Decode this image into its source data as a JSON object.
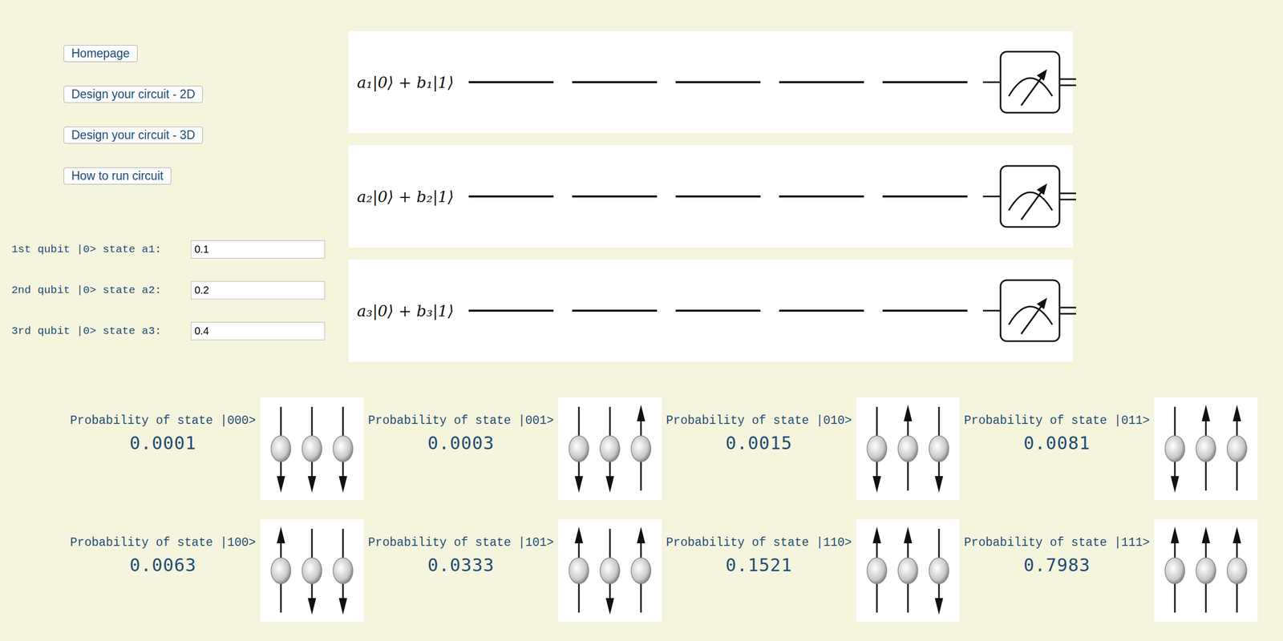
{
  "nav": {
    "buttons": [
      "Homepage",
      "Design your circuit - 2D",
      "Design your circuit - 3D",
      "How to run circuit"
    ]
  },
  "inputs": [
    {
      "label": "1st qubit |0> state a1:",
      "value": "0.1"
    },
    {
      "label": "2nd qubit |0> state a2:",
      "value": "0.2"
    },
    {
      "label": "3rd qubit |0> state a3:",
      "value": "0.4"
    }
  ],
  "circuit": {
    "qubits": [
      {
        "label": "a₁|0⟩ + b₁|1⟩"
      },
      {
        "label": "a₂|0⟩ + b₂|1⟩"
      },
      {
        "label": "a₃|0⟩ + b₃|1⟩"
      }
    ]
  },
  "probabilities": [
    {
      "label": "Probability of state |000>",
      "value": "0.0001",
      "spins": [
        "down",
        "down",
        "down"
      ]
    },
    {
      "label": "Probability of state |001>",
      "value": "0.0003",
      "spins": [
        "down",
        "down",
        "up"
      ]
    },
    {
      "label": "Probability of state |010>",
      "value": "0.0015",
      "spins": [
        "down",
        "up",
        "down"
      ]
    },
    {
      "label": "Probability of state |011>",
      "value": "0.0081",
      "spins": [
        "down",
        "up",
        "up"
      ]
    },
    {
      "label": "Probability of state |100>",
      "value": "0.0063",
      "spins": [
        "up",
        "down",
        "down"
      ]
    },
    {
      "label": "Probability of state |101>",
      "value": "0.0333",
      "spins": [
        "up",
        "down",
        "up"
      ]
    },
    {
      "label": "Probability of state |110>",
      "value": "0.1521",
      "spins": [
        "up",
        "up",
        "down"
      ]
    },
    {
      "label": "Probability of state |111>",
      "value": "0.7983",
      "spins": [
        "up",
        "up",
        "up"
      ]
    }
  ]
}
